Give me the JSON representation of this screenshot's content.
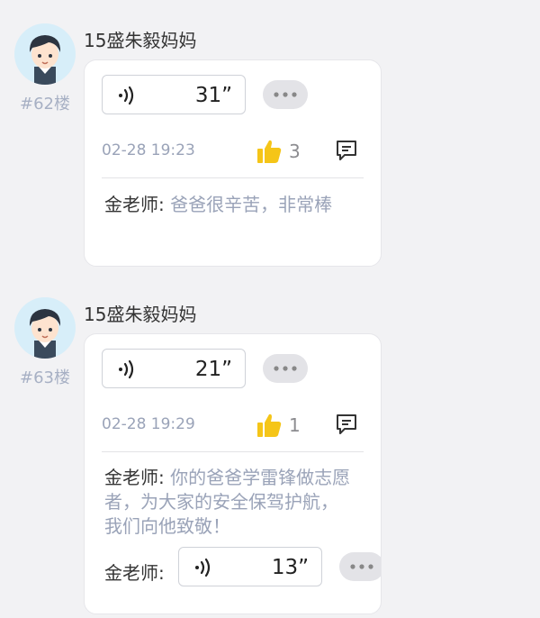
{
  "posts": [
    {
      "username": "15盛朱毅妈妈",
      "floor": "#62楼",
      "voice_duration": "31”",
      "time": "02-28 19:23",
      "like_count": "3",
      "replies": [
        {
          "author": "金老师:",
          "text": " 爸爸很辛苦，非常棒"
        }
      ]
    },
    {
      "username": "15盛朱毅妈妈",
      "floor": "#63楼",
      "voice_duration": "21”",
      "time": "02-28 19:29",
      "like_count": "1",
      "replies": [
        {
          "author": "金老师:",
          "text": " 你的爸爸学雷锋做志愿者，为大家的安全保驾护航，我们向他致敬！"
        },
        {
          "author": "金老师:",
          "voice_duration": "13”"
        }
      ]
    }
  ],
  "icons": {
    "voice": "sound-wave-icon",
    "more": "more-dots-icon",
    "like": "thumbs-up-icon",
    "comment": "comment-icon",
    "avatar": "boy-avatar"
  },
  "colors": {
    "like": "#f5c518",
    "muted_text": "#9aa3b8",
    "background": "#f2f2f4"
  }
}
